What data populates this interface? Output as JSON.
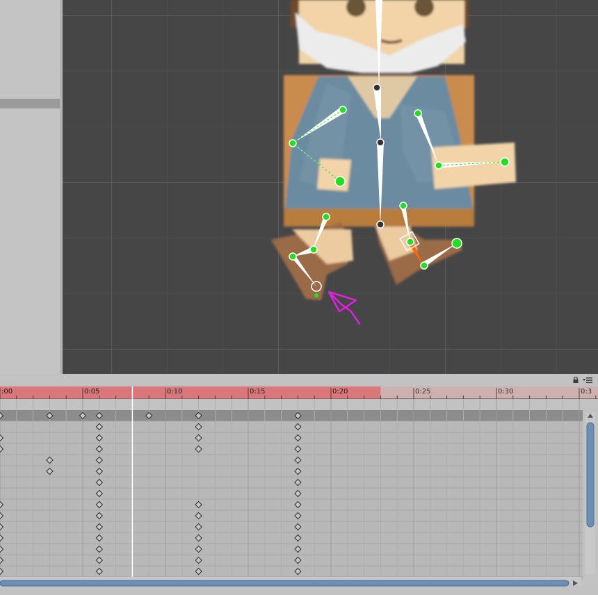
{
  "scene_view": {
    "name": "Scene view",
    "bone_color": "#ffffff",
    "joint_color": "#22dd22",
    "selected_bone_color": "#ff6a00",
    "annotation_color": "#e020e0"
  },
  "animation": {
    "ruler_labels": [
      {
        "text": ":00",
        "frame": 0
      },
      {
        "text": "0:05",
        "frame": 5
      },
      {
        "text": "0:10",
        "frame": 10
      },
      {
        "text": "0:15",
        "frame": 15
      },
      {
        "text": "0:20",
        "frame": 20
      },
      {
        "text": "0:25",
        "frame": 25
      },
      {
        "text": "0:30",
        "frame": 30
      },
      {
        "text": "0:3",
        "frame": 35
      }
    ],
    "clip_end_frame": 23,
    "playhead_frame": 8,
    "clip_range_color": "#d9777a",
    "summary_keys": [
      -2,
      0,
      3,
      5,
      6,
      9,
      12,
      18
    ],
    "tracks": [
      [
        6,
        12,
        18
      ],
      [
        -2,
        0,
        6,
        12,
        18
      ],
      [
        -2,
        0,
        6,
        12,
        18
      ],
      [
        3,
        6,
        18
      ],
      [
        3,
        6,
        18
      ],
      [
        6,
        18
      ],
      [
        6,
        18
      ],
      [
        0,
        6,
        12,
        18
      ],
      [
        0,
        6,
        12,
        18
      ],
      [
        0,
        6,
        12,
        18
      ],
      [
        0,
        6,
        12,
        18
      ],
      [
        0,
        6,
        12,
        18
      ],
      [
        0,
        6,
        12,
        18
      ],
      [
        0,
        6,
        12,
        18
      ]
    ]
  }
}
